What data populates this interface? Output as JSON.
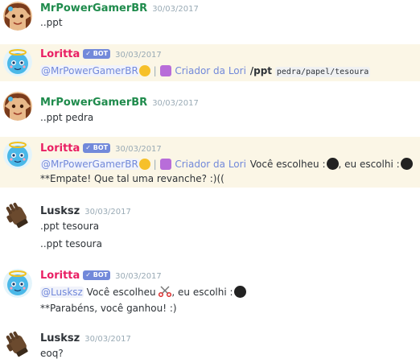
{
  "colors": {
    "mrpower": "#1f8b4c",
    "loritta": "#e91e63",
    "lusksz": "#2e3338",
    "mention": "#7289da",
    "bot_badge": "#7289da",
    "highlight": "#fbf6e6"
  },
  "bot_badge": "✓ BOT",
  "messages": [
    {
      "author": "MrPowerGamerBR",
      "timestamp": "30/03/2017",
      "lines": [
        "..ppt"
      ]
    },
    {
      "author": "Loritta",
      "timestamp": "30/03/2017",
      "mention": "@MrPowerGamerBR",
      "role": "Criador da Lori",
      "command": "/ppt",
      "args": "pedra/papel/tesoura"
    },
    {
      "author": "MrPowerGamerBR",
      "timestamp": "30/03/2017",
      "lines": [
        "..ppt pedra"
      ]
    },
    {
      "author": "Loritta",
      "timestamp": "30/03/2017",
      "mention": "@MrPowerGamerBR",
      "role": "Criador da Lori",
      "text_a": "Você escolheu :",
      "text_b": ", eu escolhi :",
      "line2": "**Empate! Que tal uma revanche? :)(("
    },
    {
      "author": "Lusksz",
      "timestamp": "30/03/2017",
      "lines": [
        ".ppt tesoura",
        "..ppt tesoura"
      ]
    },
    {
      "author": "Loritta",
      "timestamp": "30/03/2017",
      "mention": "@Lusksz",
      "text_a": "Você escolheu",
      "text_b": ", eu escolhi :",
      "line2": "**Parabéns, você ganhou! :)"
    },
    {
      "author": "Lusksz",
      "timestamp": "30/03/2017",
      "lines": [
        "eoq?"
      ]
    }
  ]
}
